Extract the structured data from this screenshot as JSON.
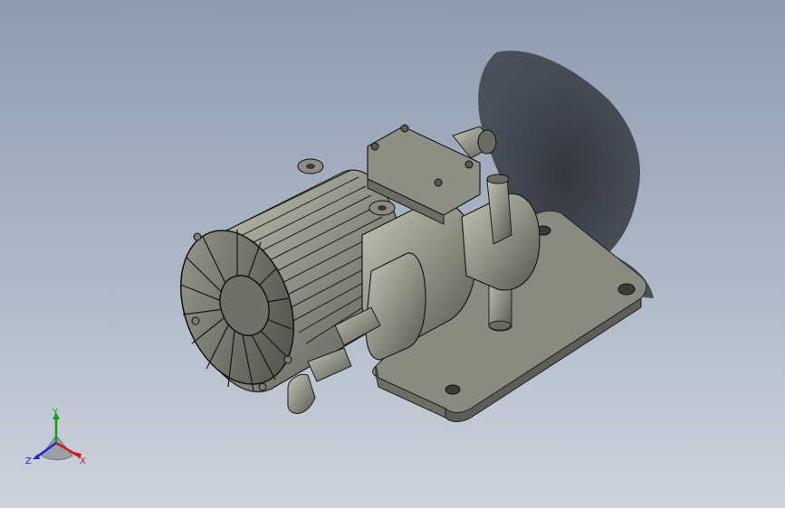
{
  "viewport": {
    "background_top": "#8f9bb0",
    "background_bottom": "#cdd3dc"
  },
  "model": {
    "part_color": "#8f9085",
    "shadow_color": "#3c4048"
  },
  "triad": {
    "x_label": "X",
    "y_label": "Y",
    "z_label": "Z",
    "x_color": "#d01a1a",
    "y_color": "#1a9a1a",
    "z_color": "#1a2ad0"
  }
}
